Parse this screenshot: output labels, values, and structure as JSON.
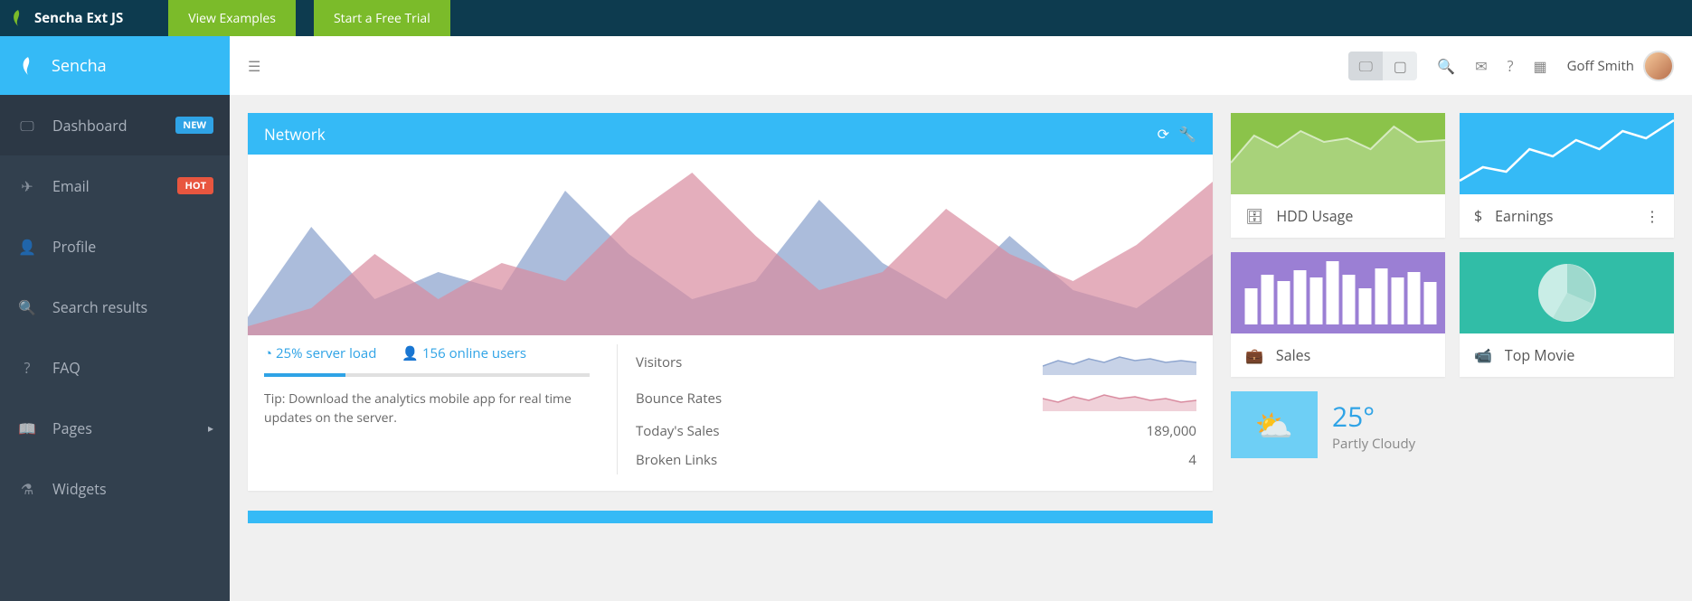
{
  "topbar": {
    "brand": "Sencha Ext JS",
    "btn_examples": "View Examples",
    "btn_trial": "Start a Free Trial"
  },
  "sidebar": {
    "brand": "Sencha",
    "items": [
      {
        "label": "Dashboard",
        "badge": "NEW",
        "badge_style": "blue",
        "active": true
      },
      {
        "label": "Email",
        "badge": "HOT",
        "badge_style": "red"
      },
      {
        "label": "Profile"
      },
      {
        "label": "Search results"
      },
      {
        "label": "FAQ"
      },
      {
        "label": "Pages",
        "chevron": true
      },
      {
        "label": "Widgets"
      }
    ]
  },
  "header": {
    "user_name": "Goff Smith"
  },
  "network": {
    "title": "Network",
    "server_load": "25% server load",
    "online_users": "156 online users",
    "tip": "Tip: Download the analytics mobile app for real time updates on the server.",
    "metrics": {
      "visitors_label": "Visitors",
      "bounce_label": "Bounce Rates",
      "sales_label": "Today's Sales",
      "sales_value": "189,000",
      "links_label": "Broken Links",
      "links_value": "4"
    }
  },
  "cards": {
    "hdd": "HDD Usage",
    "earnings": "Earnings",
    "sales": "Sales",
    "movie": "Top Movie"
  },
  "weather": {
    "temp": "25°",
    "cond": "Partly Cloudy"
  },
  "chart_data": {
    "network_area": {
      "type": "area",
      "ylim": [
        0,
        100
      ],
      "title": "Network",
      "xlabel": "",
      "ylabel": "",
      "x": [
        0,
        1,
        2,
        3,
        4,
        5,
        6,
        7,
        8,
        9,
        10,
        11,
        12,
        13,
        14,
        15
      ],
      "series": [
        {
          "name": "series-blue",
          "color": "#8fa6cf",
          "values": [
            10,
            60,
            20,
            35,
            25,
            80,
            45,
            20,
            30,
            75,
            40,
            20,
            55,
            25,
            15,
            45
          ]
        },
        {
          "name": "series-pink",
          "color": "#d98ca0",
          "values": [
            5,
            15,
            45,
            20,
            40,
            30,
            65,
            90,
            55,
            25,
            35,
            70,
            45,
            30,
            50,
            85
          ]
        }
      ]
    },
    "hdd_spark": {
      "type": "area",
      "color": "#a8d27a",
      "values": [
        40,
        70,
        55,
        75,
        60,
        65,
        50,
        80,
        60
      ]
    },
    "earnings_spark": {
      "type": "line",
      "color": "#ffffff",
      "values": [
        10,
        25,
        20,
        45,
        35,
        55,
        40,
        70,
        60,
        90
      ]
    },
    "sales_bars": {
      "type": "bar",
      "color": "#ffffff",
      "values": [
        55,
        75,
        65,
        80,
        70,
        95,
        75,
        55,
        85,
        70,
        80,
        65
      ]
    },
    "movie_pie": {
      "type": "pie",
      "values": [
        45,
        35,
        20
      ]
    },
    "visitors_spark": {
      "type": "area",
      "color": "#8fa6cf",
      "values": [
        30,
        45,
        35,
        50,
        40,
        55,
        45,
        50,
        40,
        45
      ]
    },
    "bounce_spark": {
      "type": "area",
      "color": "#d98ca0",
      "values": [
        40,
        30,
        45,
        35,
        50,
        40,
        45,
        35,
        40,
        30
      ]
    }
  }
}
